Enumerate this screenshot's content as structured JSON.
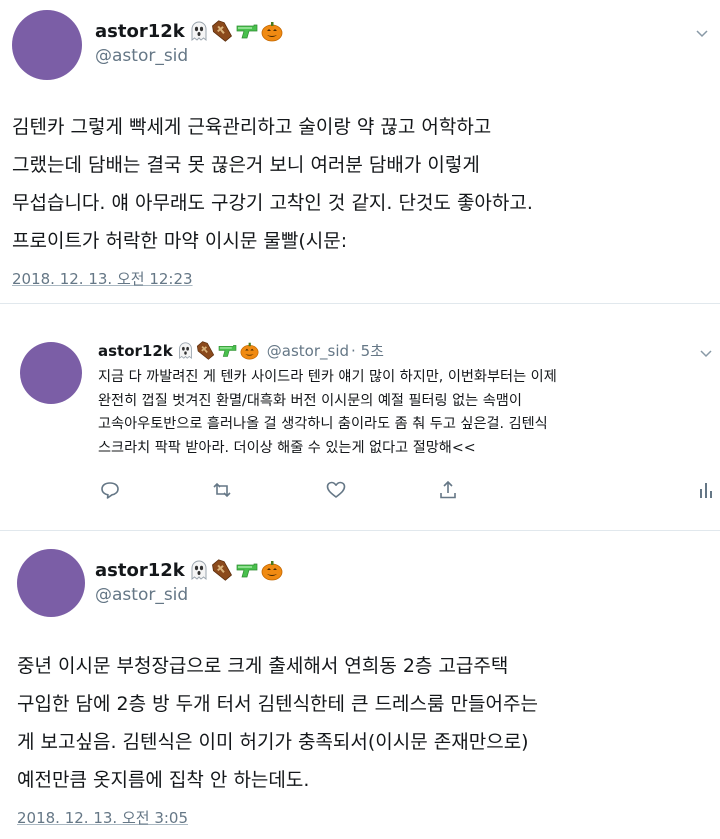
{
  "tweet1": {
    "display_name": "astor12k",
    "handle": "@astor_sid",
    "body": "김텐카 그렇게 빡세게 근육관리하고 술이랑 약 끊고 어학하고\n그랬는데 담배는 결국 못 끊은거 보니 여러분 담배가 이렇게\n무섭습니다. 얘 아무래도 구강기 고착인 것 같지. 단것도 좋아하고.\n프로이트가 허락한 마약 이시문 물빨(시문:",
    "timestamp": "2018. 12. 13. 오전 12:23"
  },
  "reply": {
    "display_name": "astor12k",
    "handle": "@astor_sid",
    "age": "· 5초",
    "body": "지금 다 까발려진 게 텐카 사이드라 텐카 얘기 많이 하지만, 이번화부터는 이제\n완전히 껍질 벗겨진 환멸/대흑화 버전 이시문의 예절 필터링 없는 속맴이\n고속아우토반으로 흘러나올 걸 생각하니 춤이라도 좀 춰 두고 싶은걸. 김텐식\n스크라치 팍팍 받아라. 더이상 해줄 수 있는게 없다고 절망해<<"
  },
  "tweet2": {
    "display_name": "astor12k",
    "handle": "@astor_sid",
    "body": "중년 이시문 부청장급으로 크게 출세해서 연희동 2층 고급주택\n구입한 담에 2층 방 두개 터서 김텐식한테 큰 드레스룸 만들어주는\n게 보고싶음. 김텐식은 이미 허기가 충족되서(이시문 존재만으로)\n예전만큼 옷지름에 집착 안 하는데도.",
    "timestamp": "2018. 12. 13. 오전 3:05"
  },
  "icons": [
    "ghost-emoji-icon",
    "coffin-emoji-icon",
    "water-gun-emoji-icon",
    "pumpkin-emoji-icon",
    "chevron-down-icon",
    "reply-icon",
    "retweet-icon",
    "like-icon",
    "share-icon",
    "analytics-icon"
  ],
  "colors": {
    "avatar": "#7b5ea6",
    "secondary_text": "#657786",
    "divider": "#e1e8ed"
  }
}
